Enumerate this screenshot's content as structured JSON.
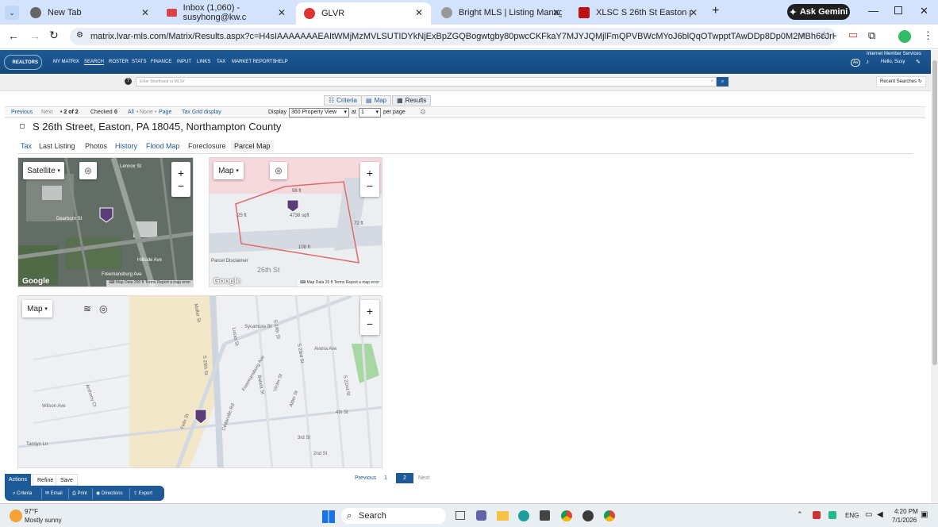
{
  "browser": {
    "tabs": [
      {
        "title": "New Tab",
        "icon": "chrome-icon"
      },
      {
        "title": "Inbox (1,060) - susyhong@kw.c",
        "icon": "gmail-icon"
      },
      {
        "title": "GLVR",
        "icon": "glvr-icon",
        "active": true
      },
      {
        "title": "Bright MLS | Listing Manageme",
        "icon": "bright-mls-icon"
      },
      {
        "title": "XLSC S 26th St Easton pdf (SEC",
        "icon": "pdf-icon"
      }
    ],
    "ask_gemini": "Ask Gemini",
    "url": "matrix.lvar-mls.com/Matrix/Results.aspx?c=H4sIAAAAAAAEAItWMjMzMVLSUTIDYkNjExBpZGQBogwtgby80pwcCKFkaY7MJYJQMjlFmQPVBWcMYoJ6blQqOTwpptTAwDDp8Dp0M2MBh6cJrHUBAAA)"
  },
  "site": {
    "logo_text": "REALTORS",
    "nav": [
      "MY MATRIX",
      "SEARCH",
      "ROSTER",
      "STATS",
      "FINANCE",
      "INPUT",
      "LINKS",
      "TAX",
      "MARKET REPORTS",
      "HELP"
    ],
    "account": {
      "type": "Internet Member Services",
      "greeting": "Hello, Susy"
    },
    "shorthand_placeholder": "Enter Shorthand or MLS#",
    "recent_searches": "Recent Searches"
  },
  "views": {
    "criteria": "Criteria",
    "map": "Map",
    "results": "Results"
  },
  "pager": {
    "previous": "Previous",
    "next": "Next",
    "position": "2 of 2",
    "checked_label": "Checked",
    "checked_count": "0",
    "all": "All",
    "none": "None",
    "page": "Page",
    "tax_grid": "Tax Grid display",
    "display_label": "Display",
    "display_value": "360 Property View",
    "at_label": "at",
    "per_page_value": "1",
    "per_page_label": "per page"
  },
  "property": {
    "address": "S 26th Street, Easton, PA 18045, Northampton County",
    "tabs": [
      "Tax",
      "Last Listing",
      "Photos",
      "History",
      "Flood Map",
      "Foreclosure",
      "Parcel Map"
    ]
  },
  "maps": {
    "satellite": {
      "type_label": "Satellite",
      "streets": [
        "Lennox St",
        "Dearborn St",
        "Freemansburg Ave",
        "Hillside Ave"
      ],
      "footer": [
        "Map Data",
        "200 ft",
        "Terms",
        "Report a map error"
      ]
    },
    "parcel": {
      "type_label": "Map",
      "dims": [
        "98 ft",
        "25 ft",
        "72 ft",
        "108 ft"
      ],
      "area": "4738 sqft",
      "disclaimer": "Parcel Disclaimer",
      "street": "26th St",
      "footer": [
        "Map Data",
        "20 ft",
        "Terms",
        "Report a map error"
      ]
    },
    "street": {
      "type_label": "Map",
      "streets": [
        "Sycamore St",
        "Freemansburg Ave",
        "S 25th St",
        "S 24th St",
        "Avona Ave",
        "Victor St",
        "Alder St",
        "4th St",
        "3rd St",
        "2nd St",
        "Tamlyn Ln",
        "Anthony Ct",
        "Felix St",
        "Lucas St",
        "Balata St",
        "Cedarville Rd",
        "Wilson Ave",
        "Moller St",
        "S 23rd St",
        "S 22nd St"
      ]
    }
  },
  "google": "Google",
  "bottom_pager": {
    "previous": "Previous",
    "page1": "1",
    "page2": "2",
    "next": "Next"
  },
  "actions": {
    "tabs": [
      "Actions",
      "Refine",
      "Save"
    ],
    "buttons": [
      "Criteria",
      "Email",
      "Print",
      "Directions",
      "Export"
    ]
  },
  "taskbar": {
    "weather_temp": "97°F",
    "weather_desc": "Mostly sunny",
    "search": "Search",
    "lang": "ENG",
    "time": "4:20 PM",
    "date": "7/1/2026"
  },
  "colors": {
    "nav": "#1e5a97",
    "pin": "#5b3e78",
    "tabbar": "#d3e3fd"
  }
}
